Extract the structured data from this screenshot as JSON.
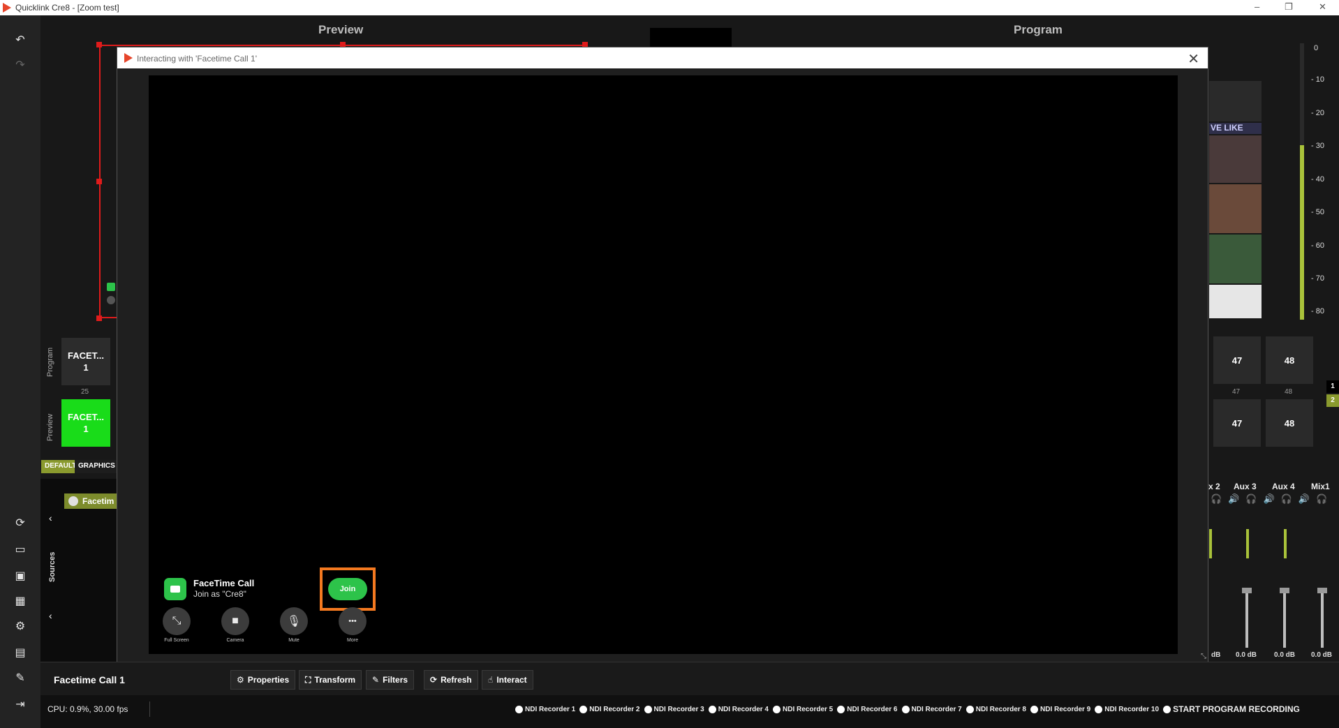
{
  "window": {
    "title": "Quicklink Cre8  - [Zoom test]",
    "controls": [
      "–",
      "❐",
      "✕"
    ]
  },
  "left_toolbar": {
    "icons": [
      "undo-icon",
      "redo-icon",
      "refresh-icon",
      "monitor-icon",
      "monitor-settings-icon",
      "grid-icon",
      "gear-icon",
      "folder-icon",
      "tools-icon",
      "exit-icon"
    ]
  },
  "headers": {
    "preview": "Preview",
    "program": "Program"
  },
  "scenes": {
    "program_label": "Program",
    "preview_label": "Preview",
    "program_scene": {
      "line1": "FACET...",
      "line2": "1"
    },
    "preview_scene": {
      "line1": "FACET...",
      "line2": "1"
    },
    "scene_number": "25",
    "tabs": [
      "DEFAULT",
      "GRAPHICS"
    ]
  },
  "sources": {
    "label": "Sources",
    "item": "Facetim"
  },
  "vu_scale": [
    "0",
    "- 10",
    "- 20",
    "- 30",
    "- 40",
    "- 50",
    "- 60",
    "- 70",
    "- 80"
  ],
  "thumbnail_caption": "VE LIKE",
  "right_buttons": {
    "row1": [
      "47",
      "48"
    ],
    "captions": [
      "47",
      "48"
    ],
    "row2": [
      "47",
      "48"
    ],
    "page_indicators": [
      "1",
      "2"
    ]
  },
  "mixer": {
    "channels": [
      "x 2",
      "Aux 3",
      "Aux 4",
      "Mix1"
    ],
    "db_values": [
      "dB",
      "0.0 dB",
      "0.0 dB",
      "0.0 dB"
    ]
  },
  "modal": {
    "title": "Interacting with 'Facetime Call 1'",
    "close": "✕",
    "facetime": {
      "title": "FaceTime Call",
      "subtitle": "Join as \"Cre8\"",
      "join_label": "Join",
      "controls": [
        {
          "label": "Full Screen",
          "icon": "fullscreen-icon",
          "glyph": "⤡"
        },
        {
          "label": "Camera",
          "icon": "camera-icon",
          "glyph": "■"
        },
        {
          "label": "Mute",
          "icon": "mic-mute-icon",
          "glyph": "🎙"
        },
        {
          "label": "More",
          "icon": "more-icon",
          "glyph": "•••"
        }
      ]
    }
  },
  "bottom": {
    "source_name": "Facetime Call 1",
    "buttons": [
      {
        "label": "Properties",
        "icon": "gear-icon",
        "glyph": "⚙"
      },
      {
        "label": "Transform",
        "icon": "transform-icon",
        "glyph": "⛶"
      },
      {
        "label": "Filters",
        "icon": "wand-icon",
        "glyph": "✎"
      },
      {
        "label": "Refresh",
        "icon": "refresh-icon",
        "glyph": "⟳"
      },
      {
        "label": "Interact",
        "icon": "hand-icon",
        "glyph": "☝"
      }
    ]
  },
  "status": {
    "cpu": "CPU: 0.9%, 30.00 fps",
    "recorders": [
      "NDI Recorder 1",
      "NDI Recorder 2",
      "NDI Recorder 3",
      "NDI Recorder 4",
      "NDI Recorder 5",
      "NDI Recorder 6",
      "NDI Recorder 7",
      "NDI Recorder 8",
      "NDI Recorder 9",
      "NDI Recorder 10"
    ],
    "record_program": "START PROGRAM RECORDING"
  },
  "colors": {
    "accent_green": "#19dc19",
    "facetime_green": "#2dc34a",
    "selection_red": "#e01b1b",
    "highlight_orange": "#f47920",
    "olive": "#7d8c2c"
  }
}
